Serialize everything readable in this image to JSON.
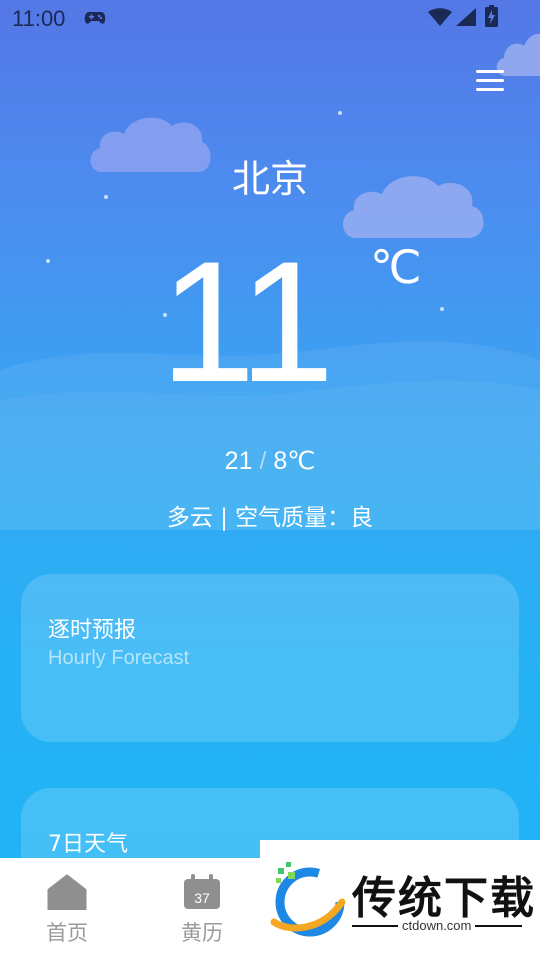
{
  "status_bar": {
    "time": "11:00",
    "icons": [
      "gamepad-icon",
      "wifi-icon",
      "signal-icon",
      "battery-icon"
    ]
  },
  "header": {
    "city": "北京",
    "menu_icon": "hamburger-icon"
  },
  "current": {
    "temperature": "11",
    "unit": "℃",
    "high": "21",
    "separator": "/",
    "low": "8℃",
    "condition": "多云 | 空气质量：良"
  },
  "cards": [
    {
      "title": "逐时预报",
      "subtitle": "Hourly Forecast"
    },
    {
      "title": "7日天气"
    }
  ],
  "bottom_nav": [
    {
      "label": "首页",
      "icon": "home-icon"
    },
    {
      "label": "黄历",
      "icon": "calendar-icon",
      "icon_text": "37"
    }
  ],
  "watermark": {
    "name": "传统下载",
    "url": "ctdown.com"
  },
  "colors": {
    "sky_top": "#5477e6",
    "sky_bottom": "#1fb4f6",
    "nav_text": "#9a9a9a"
  }
}
